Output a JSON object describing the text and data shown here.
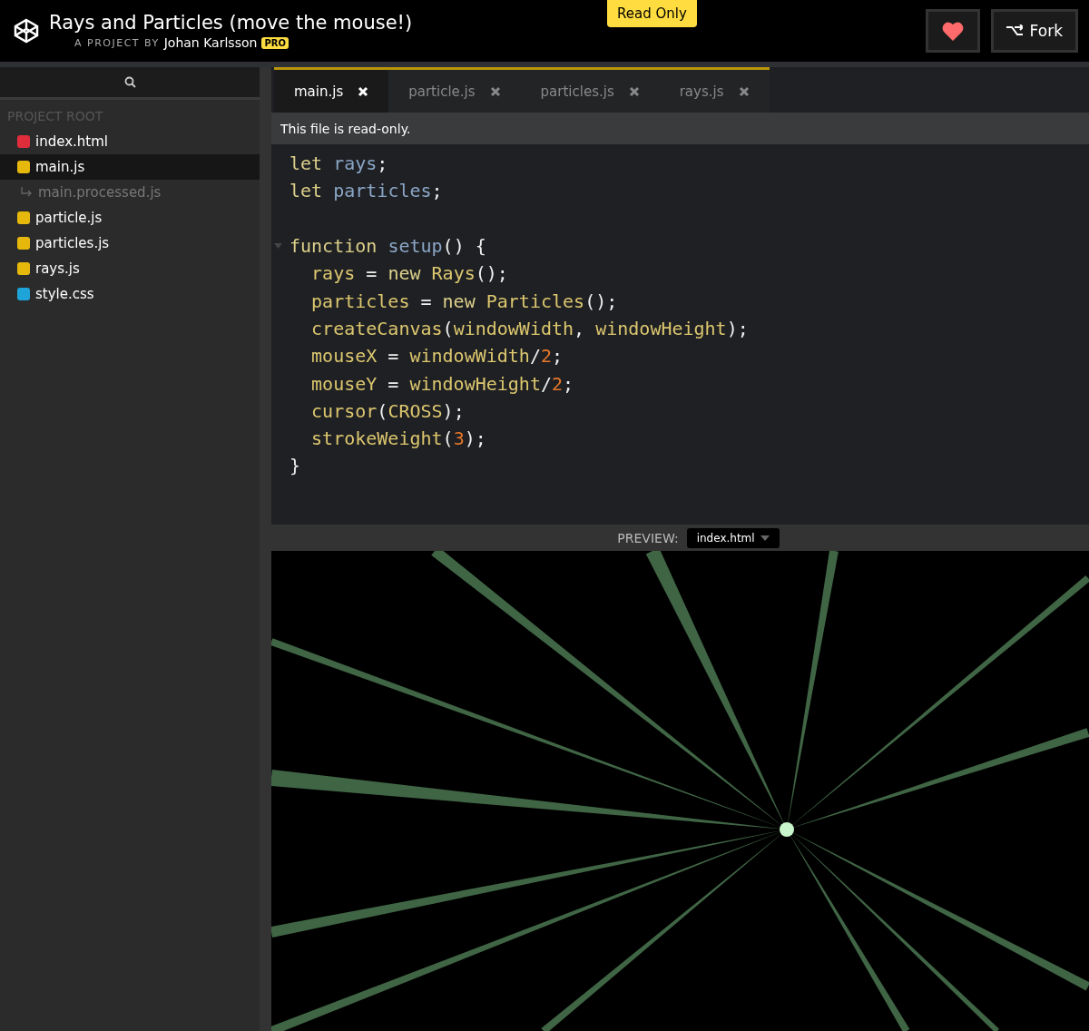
{
  "header": {
    "title": "Rays and Particles (move the mouse!)",
    "byline": "A PROJECT BY",
    "author": "Johan Karlsson",
    "badge": "PRO",
    "read_only": "Read Only",
    "fork": "Fork"
  },
  "sidebar": {
    "heading": "PROJECT ROOT",
    "files": [
      {
        "name": "index.html",
        "kind": "html",
        "selected": false
      },
      {
        "name": "main.js",
        "kind": "js",
        "selected": true
      },
      {
        "name": "main.processed.js",
        "kind": "derived",
        "selected": false
      },
      {
        "name": "particle.js",
        "kind": "js",
        "selected": false
      },
      {
        "name": "particles.js",
        "kind": "js",
        "selected": false
      },
      {
        "name": "rays.js",
        "kind": "js",
        "selected": false
      },
      {
        "name": "style.css",
        "kind": "css",
        "selected": false
      }
    ]
  },
  "tabs": [
    {
      "label": "main.js",
      "selected": true
    },
    {
      "label": "particle.js",
      "selected": false
    },
    {
      "label": "particles.js",
      "selected": false
    },
    {
      "label": "rays.js",
      "selected": false
    }
  ],
  "notice": "This file is read-only.",
  "code": [
    {
      "tokens": [
        {
          "text": "let ",
          "kind": "keyword"
        },
        {
          "text": "rays",
          "kind": "def"
        },
        {
          "text": ";",
          "kind": "punct"
        }
      ]
    },
    {
      "tokens": [
        {
          "text": "let ",
          "kind": "keyword"
        },
        {
          "text": "particles",
          "kind": "def"
        },
        {
          "text": ";",
          "kind": "punct"
        }
      ]
    },
    {
      "blank_line_before": true,
      "foldable": true,
      "tokens": [
        {
          "text": "function ",
          "kind": "keyword"
        },
        {
          "text": "setup",
          "kind": "def"
        },
        {
          "text": "() {",
          "kind": "punct"
        }
      ]
    },
    {
      "tokens": [
        {
          "text": "  rays",
          "kind": "name"
        },
        {
          "text": " = ",
          "kind": "punct"
        },
        {
          "text": "new ",
          "kind": "keyword"
        },
        {
          "text": "Rays",
          "kind": "name"
        },
        {
          "text": "();",
          "kind": "punct"
        }
      ]
    },
    {
      "tokens": [
        {
          "text": "  particles",
          "kind": "name"
        },
        {
          "text": " = ",
          "kind": "punct"
        },
        {
          "text": "new ",
          "kind": "keyword"
        },
        {
          "text": "Particles",
          "kind": "name"
        },
        {
          "text": "();",
          "kind": "punct"
        }
      ]
    },
    {
      "tokens": [
        {
          "text": "  createCanvas",
          "kind": "name"
        },
        {
          "text": "(",
          "kind": "punct"
        },
        {
          "text": "windowWidth",
          "kind": "name"
        },
        {
          "text": ", ",
          "kind": "punct"
        },
        {
          "text": "windowHeight",
          "kind": "name"
        },
        {
          "text": ");",
          "kind": "punct"
        }
      ]
    },
    {
      "tokens": [
        {
          "text": "  mouseX",
          "kind": "name"
        },
        {
          "text": " = ",
          "kind": "punct"
        },
        {
          "text": "windowWidth",
          "kind": "name"
        },
        {
          "text": "/",
          "kind": "punct"
        },
        {
          "text": "2",
          "kind": "num"
        },
        {
          "text": ";",
          "kind": "punct"
        }
      ]
    },
    {
      "tokens": [
        {
          "text": "  mouseY",
          "kind": "name"
        },
        {
          "text": " = ",
          "kind": "punct"
        },
        {
          "text": "windowHeight",
          "kind": "name"
        },
        {
          "text": "/",
          "kind": "punct"
        },
        {
          "text": "2",
          "kind": "num"
        },
        {
          "text": ";",
          "kind": "punct"
        }
      ]
    },
    {
      "tokens": [
        {
          "text": "  cursor",
          "kind": "name"
        },
        {
          "text": "(",
          "kind": "punct"
        },
        {
          "text": "CROSS",
          "kind": "name"
        },
        {
          "text": ");",
          "kind": "punct"
        }
      ]
    },
    {
      "tokens": [
        {
          "text": "  strokeWeight",
          "kind": "name"
        },
        {
          "text": "(",
          "kind": "punct"
        },
        {
          "text": "3",
          "kind": "num"
        },
        {
          "text": ");",
          "kind": "punct"
        }
      ]
    },
    {
      "tokens": [
        {
          "text": "}",
          "kind": "punct"
        }
      ]
    }
  ],
  "preview": {
    "label": "PREVIEW:",
    "file": "index.html",
    "kind": "picture"
  }
}
